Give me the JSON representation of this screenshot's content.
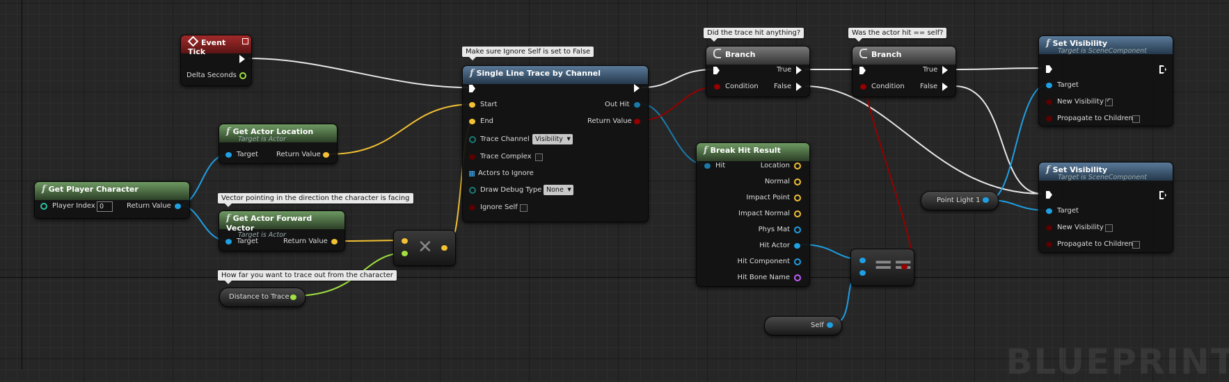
{
  "colors": {
    "exec": "#ffffff",
    "object": "#1fa0e4",
    "vector": "#f3c134",
    "bool": "#950000",
    "float": "#a0e040",
    "int": "#2bc4a0",
    "struct": "#1a7aaa",
    "string": "#c060ff"
  },
  "comments": {
    "trace_self": "Make sure Ignore Self is set to False",
    "did_hit": "Did the trace hit anything?",
    "actor_self": "Was the actor hit == self?",
    "forward": "Vector pointing in the direction the character is facing",
    "distance": "How far you want to trace out from the character"
  },
  "nodes": {
    "event_tick": {
      "title": "Event Tick",
      "delta": "Delta Seconds"
    },
    "get_player_character": {
      "title": "Get Player Character",
      "player_index_label": "Player Index",
      "player_index_value": "0",
      "return_value": "Return Value"
    },
    "get_actor_location": {
      "title": "Get Actor Location",
      "subtitle": "Target is Actor",
      "target": "Target",
      "return_value": "Return Value"
    },
    "get_forward_vector": {
      "title": "Get Actor Forward Vector",
      "subtitle": "Target is Actor",
      "target": "Target",
      "return_value": "Return Value"
    },
    "distance_var": {
      "label": "Distance to Trace"
    },
    "line_trace": {
      "title": "Single Line Trace by Channel",
      "start": "Start",
      "end": "End",
      "trace_channel": "Trace Channel",
      "trace_channel_value": "Visibility",
      "trace_complex": "Trace Complex",
      "actors_to_ignore": "Actors to Ignore",
      "draw_debug_type": "Draw Debug Type",
      "draw_debug_value": "None",
      "ignore_self": "Ignore Self",
      "out_hit": "Out Hit",
      "return_value": "Return Value"
    },
    "branch1": {
      "title": "Branch",
      "condition": "Condition",
      "true_label": "True",
      "false_label": "False"
    },
    "branch2": {
      "title": "Branch",
      "condition": "Condition",
      "true_label": "True",
      "false_label": "False"
    },
    "break_hit": {
      "title": "Break Hit Result",
      "hit": "Hit",
      "outputs": [
        "Location",
        "Normal",
        "Impact Point",
        "Impact Normal",
        "Phys Mat",
        "Hit Actor",
        "Hit Component",
        "Hit Bone Name"
      ]
    },
    "self_var": {
      "label": "Self"
    },
    "point_light": {
      "label": "Point Light 1"
    },
    "set_vis1": {
      "title": "Set Visibility",
      "subtitle": "Target is SceneComponent",
      "target": "Target",
      "new_visibility": "New Visibility",
      "propagate": "Propagate to Children",
      "new_visibility_checked": true
    },
    "set_vis2": {
      "title": "Set Visibility",
      "subtitle": "Target is SceneComponent",
      "target": "Target",
      "new_visibility": "New Visibility",
      "propagate": "Propagate to Children",
      "new_visibility_checked": false
    }
  },
  "watermark": "BLUEPRINT"
}
